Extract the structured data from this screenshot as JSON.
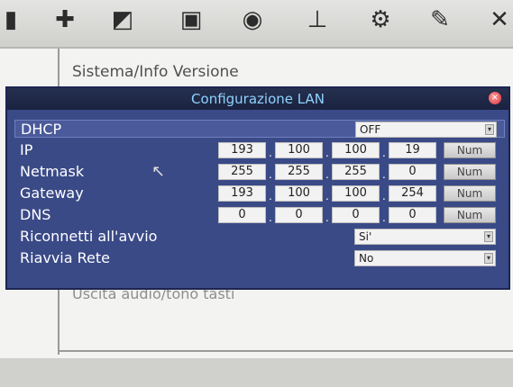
{
  "toolbar": {
    "icons": [
      "tools-icon",
      "marker-icon",
      "clapper-icon",
      "monitor-icon",
      "camera-icon",
      "usb-icon",
      "gear-icon",
      "pen-icon",
      "network-icon"
    ]
  },
  "background": {
    "title": "Sistema/Info Versione",
    "audio_text": "Uscita audio/tono tasti"
  },
  "dialog": {
    "title": "Configurazione LAN",
    "rows": {
      "dhcp": {
        "label": "DHCP",
        "value": "OFF"
      },
      "ip": {
        "label": "IP",
        "octets": [
          "193",
          "100",
          "100",
          "19"
        ],
        "button": "Num"
      },
      "netmask": {
        "label": "Netmask",
        "octets": [
          "255",
          "255",
          "255",
          "0"
        ],
        "button": "Num"
      },
      "gateway": {
        "label": "Gateway",
        "octets": [
          "193",
          "100",
          "100",
          "254"
        ],
        "button": "Num"
      },
      "dns": {
        "label": "DNS",
        "octets": [
          "0",
          "0",
          "0",
          "0"
        ],
        "button": "Num"
      },
      "reconnect": {
        "label": "Riconnetti all'avvio",
        "value": "Si'"
      },
      "restart": {
        "label": "Riavvia Rete",
        "value": "No"
      }
    }
  },
  "colors": {
    "dialog_bg": "#3a4a87",
    "dialog_title": "#8fd3ff",
    "close_button": "#d8303a"
  }
}
